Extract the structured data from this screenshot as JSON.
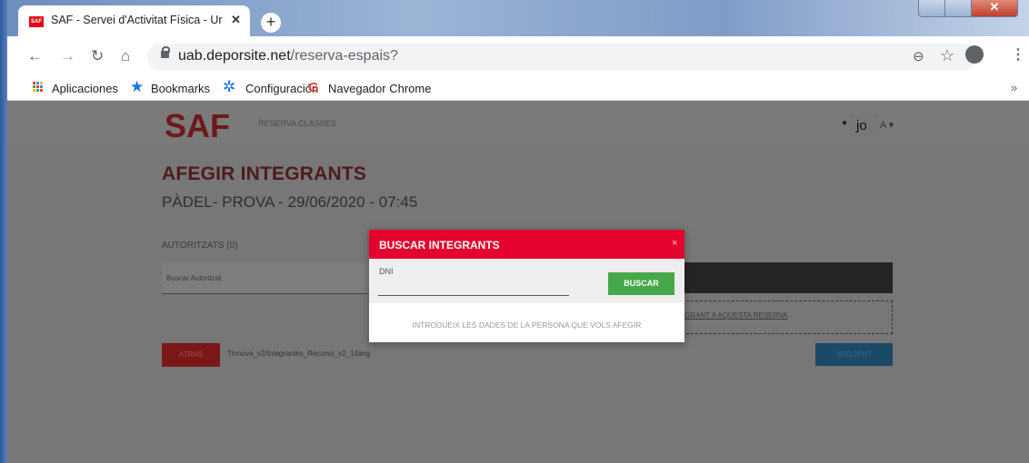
{
  "browser": {
    "tab_title": "SAF - Servei d'Activitat Física - Ur",
    "tab_logo": "SAF",
    "url_host": "uab.deporsite.net",
    "url_path": "/reserva-espais?",
    "bookmarks": [
      "Aplicaciones",
      "Bookmarks",
      "Configuración",
      "Navegador Chrome"
    ],
    "new_tab": "+",
    "more": "»"
  },
  "header": {
    "logo_text": "SAF",
    "nav_link": "RESERVA CLASSES",
    "user_name": "jo",
    "user_drop": "A ▾"
  },
  "page": {
    "title": "AFEGIR INTEGRANTS",
    "subtitle": "PÀDEL- PROVA - 29/06/2020 - 07:45",
    "autoritzats_label": "AUTORITZATS (0)",
    "buscar_autoritzat": "Buscar Autoritzat",
    "dashed_text": "GRANT A AQUESTA RESERVA",
    "atras": "ATRAS",
    "atras_path": "Tlnnova_v2/Integrantes_Recurso_v2_1/lang",
    "seguent": "SEGÜENT"
  },
  "modal": {
    "title": "BUSCAR INTEGRANTS",
    "close": "×",
    "dni_label": "DNI",
    "dni_value": "",
    "search_button": "BUSCAR",
    "hint": "INTRODUEIX LES DADES DE LA PERSONA QUE VOLS AFEGIR"
  },
  "colors": {
    "modal_header": "#e4032e",
    "search_button": "#47a84b",
    "page_title": "#4f1a1f"
  },
  "icons": [
    "back-icon",
    "forward-icon",
    "reload-icon",
    "home-icon",
    "lock-icon",
    "zoom-icon",
    "star-icon",
    "profile-icon",
    "menu-icon",
    "apps-icon",
    "gear-icon",
    "google-icon",
    "user-icon"
  ]
}
